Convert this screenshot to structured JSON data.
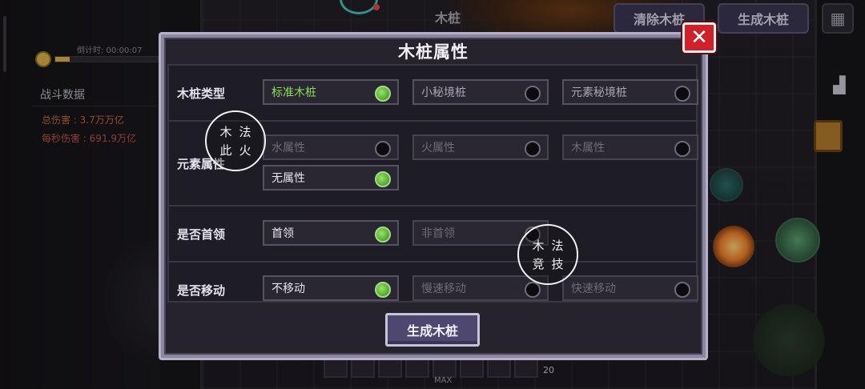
{
  "hud": {
    "countdown_label": "倒计时: 00:00:07",
    "countdown_progress": 0.14,
    "stats_title": "战斗数据",
    "total_damage": "总伤害 : 3.7万万亿",
    "dps": "每秒伤害 : 691.9万亿",
    "top_label": "木桩",
    "clear_button": "清除木桩",
    "spawn_button_top": "生成木桩",
    "hotbar_count": "20",
    "max_label": "MAX"
  },
  "modal": {
    "title": "木桩属性",
    "close": "✕",
    "rows": [
      {
        "label": "木桩类型",
        "options": [
          {
            "text": "标准木桩",
            "selected": true
          },
          {
            "text": "小秘境桩",
            "selected": false
          },
          {
            "text": "元素秘境桩",
            "selected": false
          }
        ]
      },
      {
        "label": "元素属性",
        "options": [
          {
            "text": "水属性",
            "selected": false
          },
          {
            "text": "火属性",
            "selected": false
          },
          {
            "text": "木属性",
            "selected": false
          },
          {
            "text": "无属性",
            "selected": true
          }
        ]
      },
      {
        "label": "是否首领",
        "options": [
          {
            "text": "首领",
            "selected": true
          },
          {
            "text": "非首领",
            "selected": false
          }
        ]
      },
      {
        "label": "是否移动",
        "options": [
          {
            "text": "不移动",
            "selected": true
          },
          {
            "text": "慢速移动",
            "selected": false
          },
          {
            "text": "快速移动",
            "selected": false
          }
        ]
      }
    ],
    "generate_button": "生成木桩"
  },
  "watermarks": [
    {
      "chars": [
        "木",
        "法",
        "此",
        "火"
      ]
    },
    {
      "chars": [
        "木",
        "法",
        "竞",
        "技"
      ]
    }
  ],
  "colors": {
    "selected_dot": "#5fb43a",
    "close_button": "#d0202a",
    "selected_type_text": "#88e05a"
  }
}
